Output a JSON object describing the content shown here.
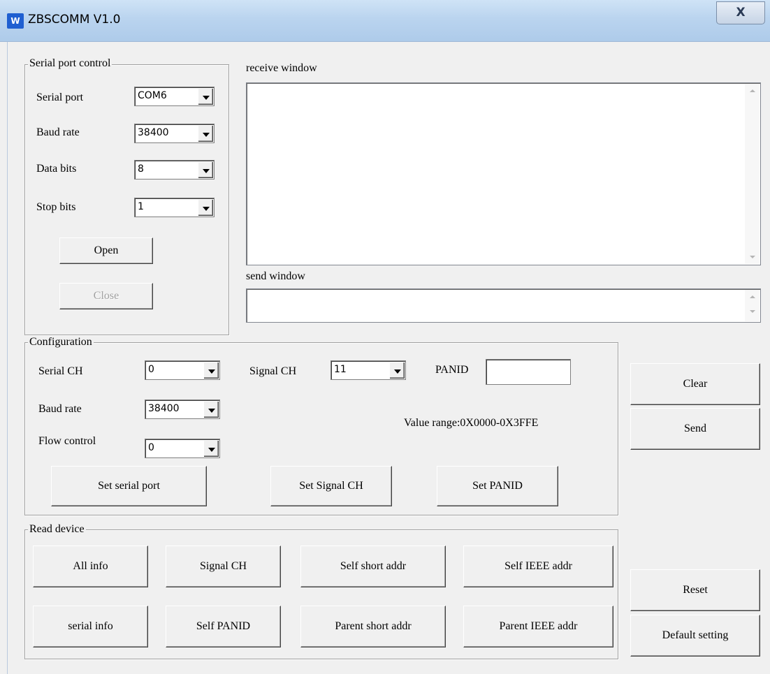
{
  "window": {
    "title": "ZBSCOMM V1.0",
    "close_label": "X",
    "icon_label": "W"
  },
  "serial_port_control": {
    "legend": "Serial port control",
    "serial_port": {
      "label": "Serial port",
      "value": "COM6"
    },
    "baud_rate": {
      "label": "Baud rate",
      "value": "38400"
    },
    "data_bits": {
      "label": "Data bits",
      "value": "8"
    },
    "stop_bits": {
      "label": "Stop bits",
      "value": "1"
    },
    "open_label": "Open",
    "close_label": "Close"
  },
  "receive_window": {
    "label": "receive window",
    "value": ""
  },
  "send_window": {
    "label": "send window",
    "value": ""
  },
  "configuration": {
    "legend": "Configuration",
    "serial_ch": {
      "label": "Serial CH",
      "value": "0"
    },
    "baud_rate": {
      "label": "Baud rate",
      "value": "38400"
    },
    "flow_control": {
      "label": "Flow control",
      "value": "0"
    },
    "signal_ch": {
      "label": "Signal CH",
      "value": "11"
    },
    "panid": {
      "label": "PANID",
      "value": ""
    },
    "value_range": "Value range:0X0000-0X3FFE",
    "set_serial_port_label": "Set serial port",
    "set_signal_ch_label": "Set Signal CH",
    "set_panid_label": "Set PANID"
  },
  "side_buttons": {
    "clear": "Clear",
    "send": "Send",
    "reset": "Reset",
    "default_setting": "Default setting"
  },
  "read_device": {
    "legend": "Read device",
    "all_info": "All info",
    "signal_ch": "Signal CH",
    "self_short_addr": "Self short addr",
    "self_ieee_addr": "Self IEEE addr",
    "serial_info": "serial info",
    "self_panid": "Self PANID",
    "parent_short_addr": "Parent short addr",
    "parent_ieee_addr": "Parent IEEE addr"
  }
}
